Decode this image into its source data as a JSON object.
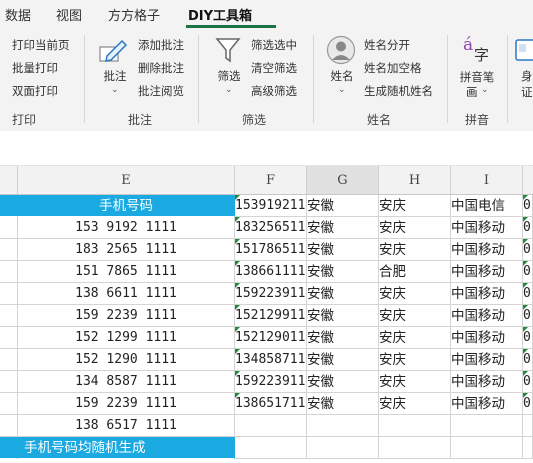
{
  "tabs": [
    "数据",
    "视图",
    "方方格子",
    "DIY工具箱"
  ],
  "ribbon": {
    "print": {
      "items": [
        "打印当前页",
        "批量打印",
        "双面打印"
      ],
      "group": "打印"
    },
    "comment": {
      "big_label": "批注",
      "items": [
        "添加批注",
        "删除批注",
        "批注阅览"
      ],
      "group": "批注"
    },
    "filter": {
      "big_label": "筛选",
      "items": [
        "筛选选中",
        "清空筛选",
        "高级筛选"
      ],
      "group": "筛选"
    },
    "name": {
      "big_label": "姓名",
      "items": [
        "姓名分开",
        "姓名加空格",
        "生成随机姓名"
      ],
      "group": "姓名"
    },
    "pinyin": {
      "big_label_1": "拼音笔",
      "big_label_2": "画",
      "icon_text_1": "á",
      "icon_text_2": "字",
      "group": "拼音"
    },
    "last": {
      "label_1": "身",
      "label_2": "证"
    }
  },
  "columns": [
    "E",
    "F",
    "G",
    "H",
    "I"
  ],
  "sheet": {
    "header": "手机号码",
    "phones": [
      "153 9192 1111",
      "183 2565 1111",
      "151 7865 1111",
      "138 6611 1111",
      "159 2239 1111",
      "152 1299 1111",
      "152 1290 1111",
      "134 8587 1111",
      "159 2239 1111",
      "138 6517 1111"
    ],
    "note": "手机号码均随机生成",
    "rows": [
      {
        "f": "153919211",
        "g": "安徽",
        "h": "安庆",
        "i": "中国电信",
        "j": "0"
      },
      {
        "f": "183256511",
        "g": "安徽",
        "h": "安庆",
        "i": "中国移动",
        "j": "0"
      },
      {
        "f": "151786511",
        "g": "安徽",
        "h": "安庆",
        "i": "中国移动",
        "j": "0"
      },
      {
        "f": "138661111",
        "g": "安徽",
        "h": "合肥",
        "i": "中国移动",
        "j": "0"
      },
      {
        "f": "159223911",
        "g": "安徽",
        "h": "安庆",
        "i": "中国移动",
        "j": "0"
      },
      {
        "f": "152129911",
        "g": "安徽",
        "h": "安庆",
        "i": "中国移动",
        "j": "0"
      },
      {
        "f": "152129011",
        "g": "安徽",
        "h": "安庆",
        "i": "中国移动",
        "j": "0"
      },
      {
        "f": "134858711",
        "g": "安徽",
        "h": "安庆",
        "i": "中国移动",
        "j": "0"
      },
      {
        "f": "159223911",
        "g": "安徽",
        "h": "安庆",
        "i": "中国移动",
        "j": "0"
      },
      {
        "f": "138651711",
        "g": "安徽",
        "h": "安庆",
        "i": "中国移动",
        "j": "0"
      }
    ]
  },
  "colors": {
    "header_fill": "#1aa9e1",
    "ribbon_accent": "#1e7145",
    "comment_triangle": "#1f8a3e"
  }
}
